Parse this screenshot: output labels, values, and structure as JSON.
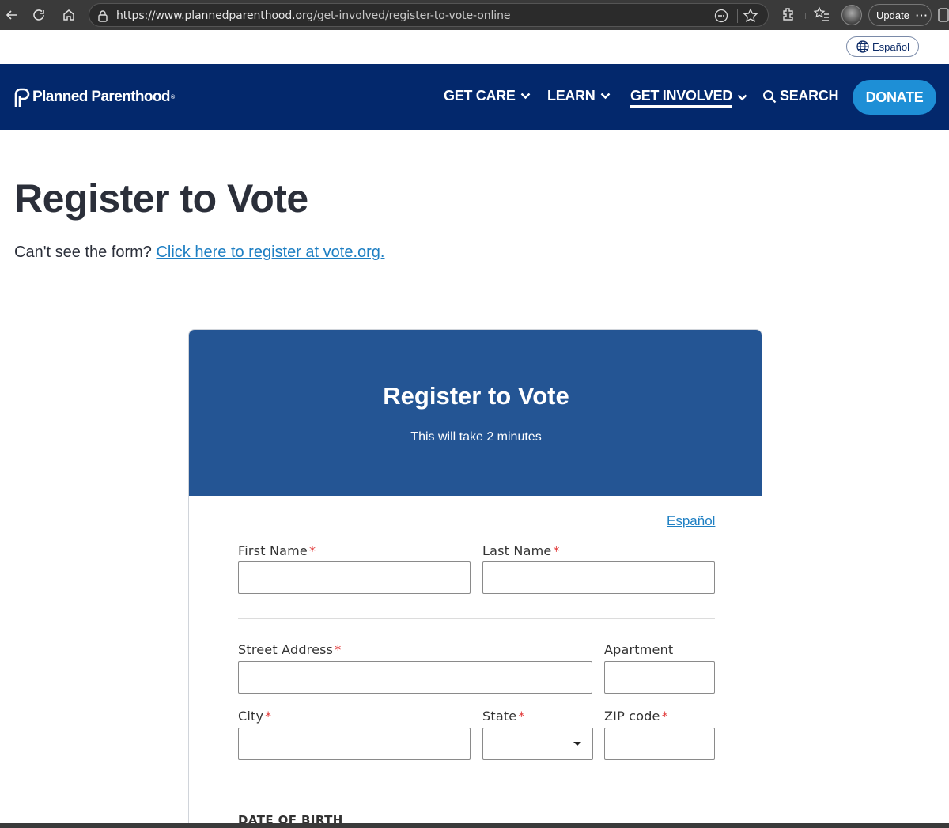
{
  "browser": {
    "url_host": "https://www.plannedparenthood.org",
    "url_path": "/get-involved/register-to-vote-online",
    "update_label": "Update",
    "more_label": "···"
  },
  "language_toggle": {
    "label": "Español"
  },
  "nav": {
    "logo_text": "Planned Parenthood",
    "items": [
      {
        "label": "GET CARE"
      },
      {
        "label": "LEARN"
      },
      {
        "label": "GET INVOLVED"
      }
    ],
    "search_label": "SEARCH",
    "donate_label": "DONATE"
  },
  "page": {
    "title": "Register to Vote",
    "help_text": "Can't see the form?",
    "help_link": "Click here to register at vote.org."
  },
  "form": {
    "title": "Register to Vote",
    "subtitle": "This will take 2 minutes",
    "language_link": "Español",
    "fields": {
      "first_name": {
        "label": "First Name",
        "value": ""
      },
      "last_name": {
        "label": "Last Name",
        "value": ""
      },
      "street_address": {
        "label": "Street Address",
        "value": ""
      },
      "apartment": {
        "label": "Apartment",
        "value": ""
      },
      "city": {
        "label": "City",
        "value": ""
      },
      "state": {
        "label": "State",
        "value": ""
      },
      "zip": {
        "label": "ZIP code",
        "value": ""
      }
    },
    "required_marker": "*",
    "dob_heading": "DATE OF BIRTH"
  },
  "colors": {
    "nav_bg": "#03286c",
    "card_header_bg": "#245594",
    "donate_bg": "#1e8fd6",
    "link": "#1e7fc3",
    "required": "#e23c3c"
  }
}
